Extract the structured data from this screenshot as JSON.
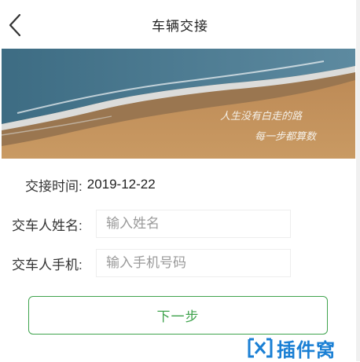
{
  "header": {
    "title": "车辆交接",
    "back_icon": "chevron-left-icon"
  },
  "banner": {
    "poem_line1": "人生没有白走的路",
    "poem_line2": "每一步都算数"
  },
  "form": {
    "handover_time_label": "交接时间:",
    "handover_time_value": "2019-12-22",
    "name_label": "交车人姓名:",
    "name_placeholder": "输入姓名",
    "name_value": "",
    "phone_label": "交车人手机:",
    "phone_placeholder": "输入手机号码",
    "phone_value": ""
  },
  "actions": {
    "next_label": "下一步"
  },
  "watermark": {
    "icon": "logo-icon",
    "text": "插件窝"
  },
  "colors": {
    "accent": "#3fa34d",
    "watermark": "#1a7fd4",
    "sand": "#c9955a",
    "sea": "#3f6f86"
  }
}
